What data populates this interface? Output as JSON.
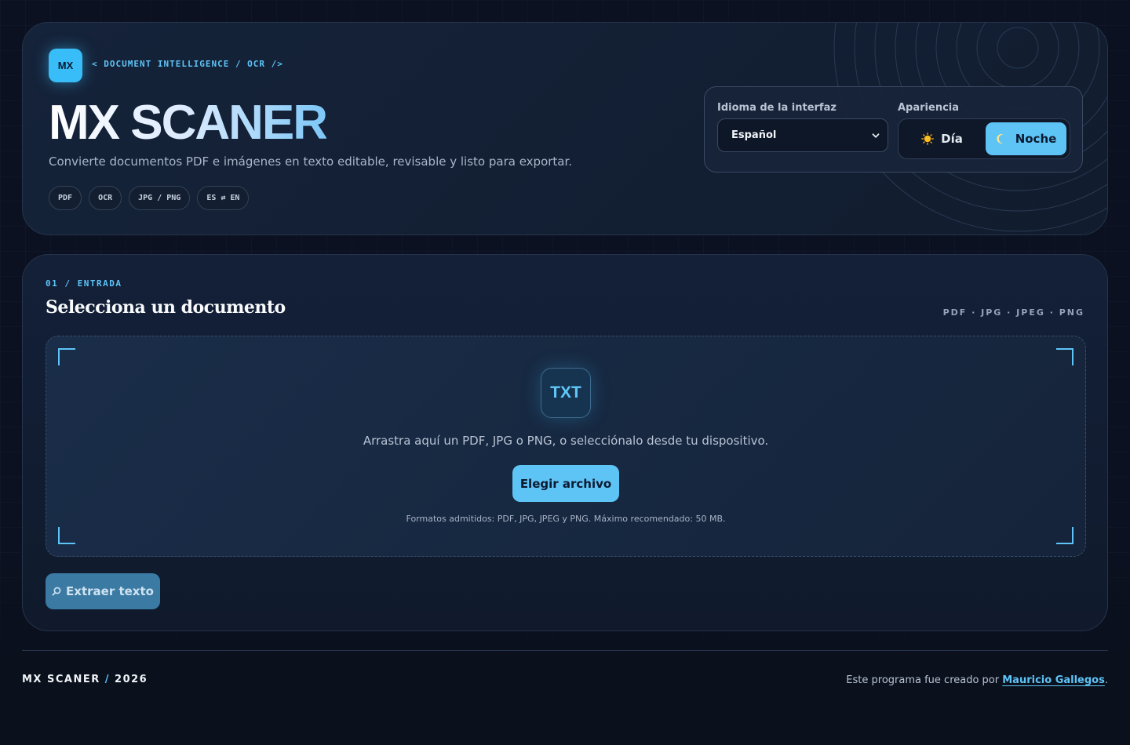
{
  "header": {
    "logo_text": "MX",
    "kicker": "< DOCUMENT INTELLIGENCE / OCR />",
    "title": "MX SCANER",
    "subtitle": "Convierte documentos PDF e imágenes en texto editable, revisable y listo para exportar.",
    "chips": [
      "PDF",
      "OCR",
      "JPG / PNG",
      "ES ⇄ EN"
    ]
  },
  "settings": {
    "language_label": "Idioma de la interfaz",
    "language_value": "Español",
    "appearance_label": "Apariencia",
    "day_icon": "sun-icon",
    "day_label": "Día",
    "night_icon": "moon-icon",
    "night_label": "Noche",
    "active_theme": "night"
  },
  "input_panel": {
    "step": "01 / ENTRADA",
    "title": "Selecciona un documento",
    "formats": "PDF · JPG · JPEG · PNG",
    "badge": "TXT",
    "drop_text": "Arrastra aquí un PDF, JPG o PNG, o selecciónalo desde tu dispositivo.",
    "choose_button": "Elegir archivo",
    "note": "Formatos admitidos: PDF, JPG, JPEG y PNG. Máximo recomendado: 50 MB.",
    "extract_icon": "search-icon",
    "extract_button": "Extraer texto"
  },
  "footer": {
    "brand": "MX SCANER",
    "slash": "/",
    "year": "2026",
    "credit_prefix": "Este programa fue creado por ",
    "author": "Mauricio Gallegos",
    "credit_suffix": "."
  },
  "colors": {
    "accent": "#5ec3f5",
    "background": "#0b1120",
    "card": "#132038"
  }
}
